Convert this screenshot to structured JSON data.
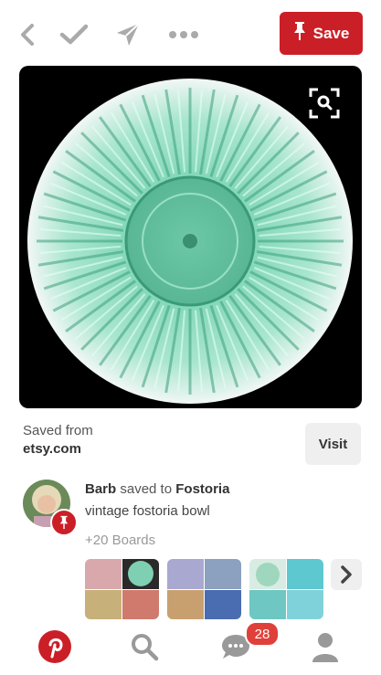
{
  "topbar": {
    "icons": [
      "back-chevron-icon",
      "checkmark-icon",
      "send-icon",
      "more-dots-icon"
    ],
    "save_label": "Save"
  },
  "image": {
    "description_icon": "visual-search-icon"
  },
  "source": {
    "label": "Saved from",
    "domain": "etsy.com",
    "visit_label": "Visit"
  },
  "pinner": {
    "name": "Barb",
    "action": "saved to",
    "board": "Fostoria",
    "description": "vintage fostoria bowl",
    "boards_more": "+20 Boards"
  },
  "bottom_nav": {
    "items": [
      "pinterest-logo-icon",
      "search-icon",
      "messages-icon",
      "profile-icon"
    ],
    "notification_count": "28"
  },
  "colors": {
    "brand_red": "#cb1f27",
    "badge_red": "#e0403a",
    "glass_green": "#7fd6b8"
  }
}
